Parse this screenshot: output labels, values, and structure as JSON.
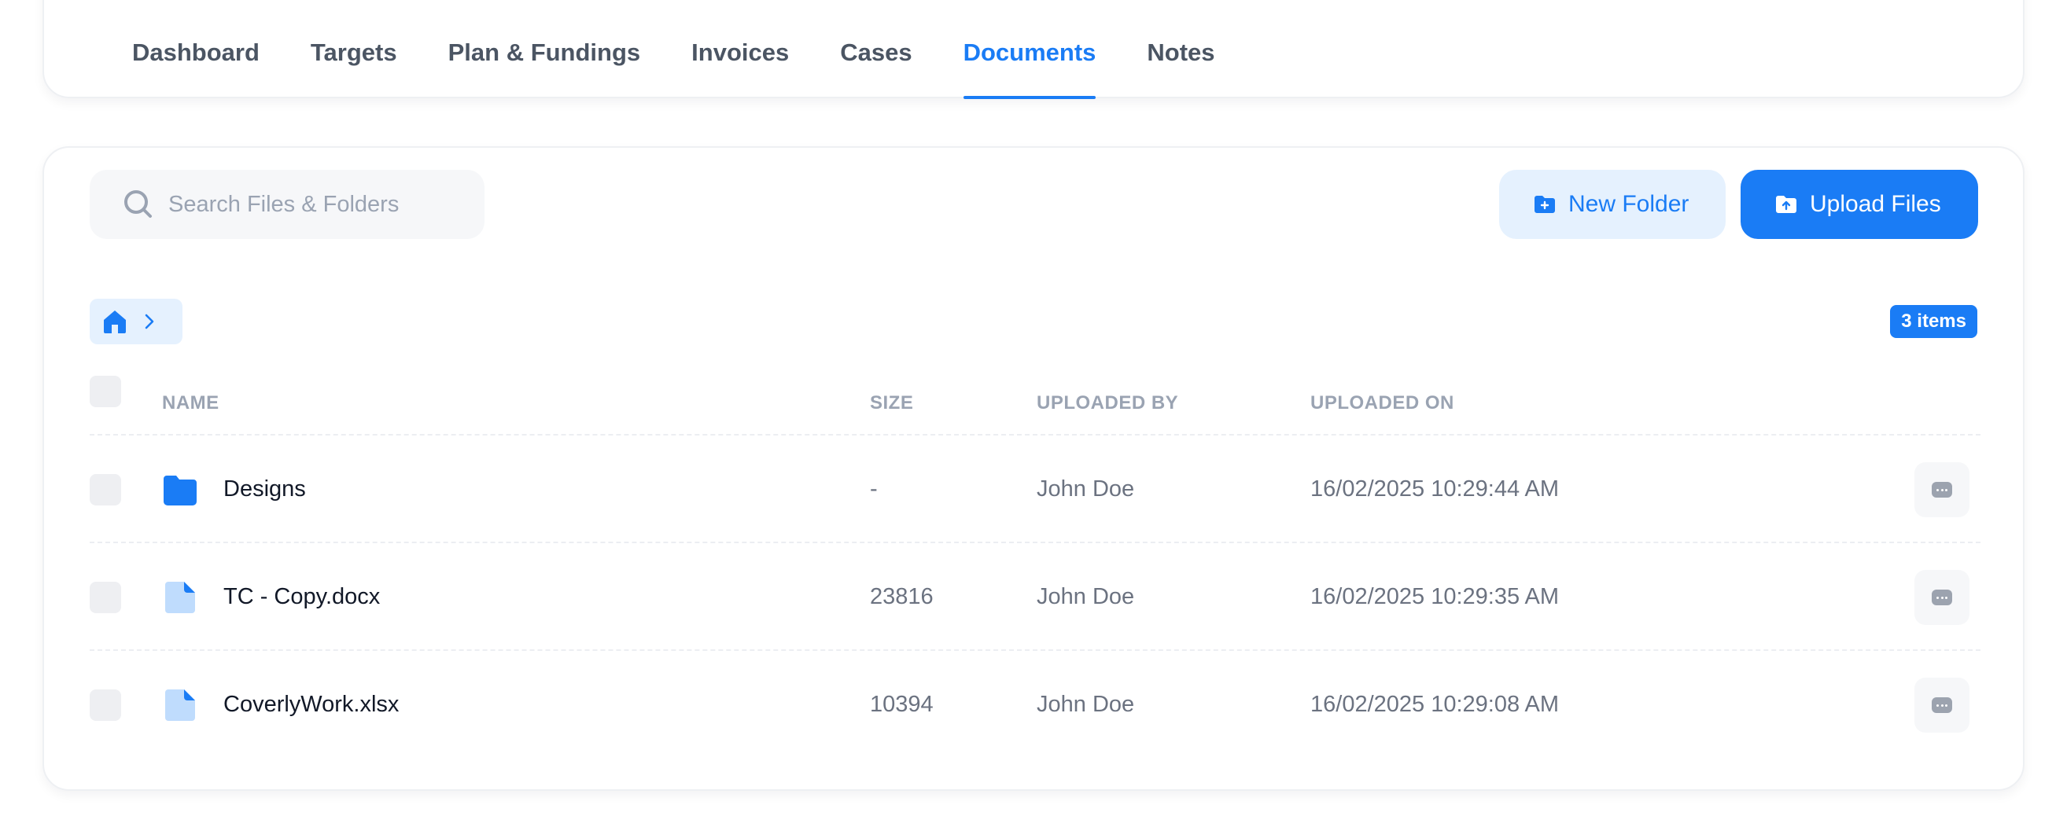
{
  "nav": {
    "tabs": [
      {
        "label": "Dashboard",
        "active": false
      },
      {
        "label": "Targets",
        "active": false
      },
      {
        "label": "Plan & Fundings",
        "active": false
      },
      {
        "label": "Invoices",
        "active": false
      },
      {
        "label": "Cases",
        "active": false
      },
      {
        "label": "Documents",
        "active": true
      },
      {
        "label": "Notes",
        "active": false
      }
    ]
  },
  "toolbar": {
    "search_placeholder": "Search Files & Folders",
    "new_folder_label": "New Folder",
    "upload_label": "Upload Files"
  },
  "breadcrumb": {
    "home_icon": "home-icon",
    "separator_icon": "chevron-right-icon"
  },
  "count_badge": "3 items",
  "table": {
    "headers": {
      "name": "NAME",
      "size": "SIZE",
      "uploaded_by": "UPLOADED BY",
      "uploaded_on": "UPLOADED ON"
    },
    "rows": [
      {
        "type": "folder",
        "name": "Designs",
        "size": "-",
        "uploaded_by": "John Doe",
        "uploaded_on": "16/02/2025 10:29:44 AM"
      },
      {
        "type": "file",
        "name": "TC - Copy.docx",
        "size": "23816",
        "uploaded_by": "John Doe",
        "uploaded_on": "16/02/2025 10:29:35 AM"
      },
      {
        "type": "file",
        "name": "CoverlyWork.xlsx",
        "size": "10394",
        "uploaded_by": "John Doe",
        "uploaded_on": "16/02/2025 10:29:08 AM"
      }
    ]
  },
  "colors": {
    "accent": "#1a7cf5",
    "accent_light": "#e5f1fe",
    "file_icon": "#bfdcfd"
  }
}
